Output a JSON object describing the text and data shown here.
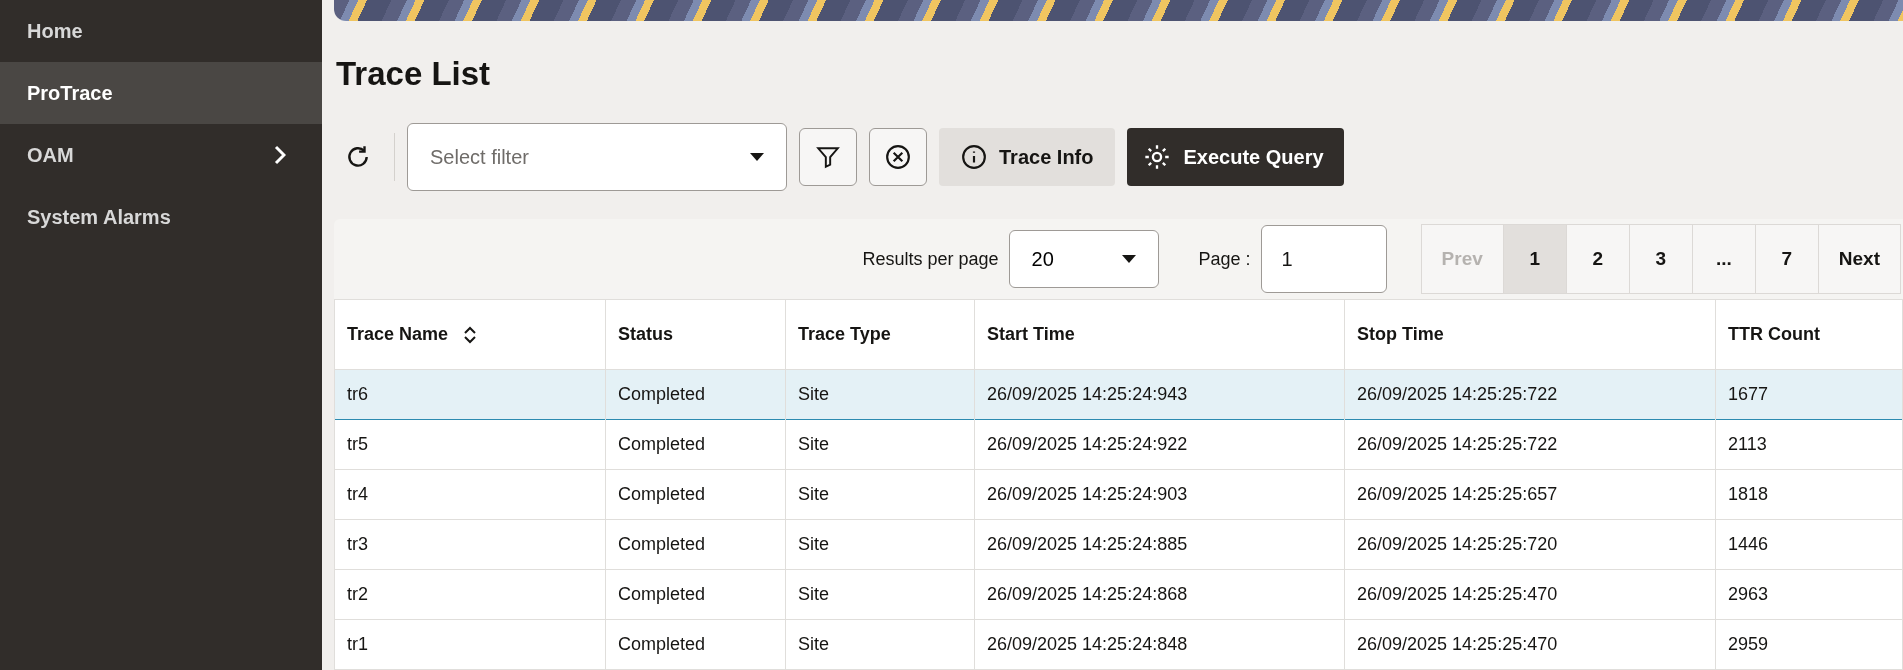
{
  "sidebar": {
    "items": [
      {
        "label": "Home",
        "selected": false,
        "expandable": false
      },
      {
        "label": "ProTrace",
        "selected": true,
        "expandable": false
      },
      {
        "label": "OAM",
        "selected": false,
        "expandable": true
      },
      {
        "label": "System Alarms",
        "selected": false,
        "expandable": false
      }
    ]
  },
  "page_title": "Trace List",
  "toolbar": {
    "filter": {
      "placeholder": "Select filter"
    },
    "trace_info_button": "Trace Info",
    "execute_button": "Execute Query"
  },
  "pagination": {
    "results_label": "Results per page",
    "results_value": "20",
    "page_label": "Page :",
    "page_value": "1",
    "pages": [
      {
        "label": "Prev",
        "selected": false,
        "disabled": true
      },
      {
        "label": "1",
        "selected": true,
        "disabled": false
      },
      {
        "label": "2",
        "selected": false,
        "disabled": false
      },
      {
        "label": "3",
        "selected": false,
        "disabled": false
      },
      {
        "label": "...",
        "selected": false,
        "disabled": false
      },
      {
        "label": "7",
        "selected": false,
        "disabled": false
      },
      {
        "label": "Next",
        "selected": false,
        "disabled": false
      }
    ]
  },
  "table": {
    "columns": [
      {
        "label": "Trace Name",
        "sortable": true
      },
      {
        "label": "Status",
        "sortable": false
      },
      {
        "label": "Trace Type",
        "sortable": false
      },
      {
        "label": "Start Time",
        "sortable": false
      },
      {
        "label": "Stop Time",
        "sortable": false
      },
      {
        "label": "TTR Count",
        "sortable": false
      }
    ],
    "rows": [
      {
        "selected": true,
        "cells": [
          "tr6",
          "Completed",
          "Site",
          "26/09/2025 14:25:24:943",
          "26/09/2025 14:25:25:722",
          "1677"
        ]
      },
      {
        "selected": false,
        "cells": [
          "tr5",
          "Completed",
          "Site",
          "26/09/2025 14:25:24:922",
          "26/09/2025 14:25:25:722",
          "2113"
        ]
      },
      {
        "selected": false,
        "cells": [
          "tr4",
          "Completed",
          "Site",
          "26/09/2025 14:25:24:903",
          "26/09/2025 14:25:25:657",
          "1818"
        ]
      },
      {
        "selected": false,
        "cells": [
          "tr3",
          "Completed",
          "Site",
          "26/09/2025 14:25:24:885",
          "26/09/2025 14:25:25:720",
          "1446"
        ]
      },
      {
        "selected": false,
        "cells": [
          "tr2",
          "Completed",
          "Site",
          "26/09/2025 14:25:24:868",
          "26/09/2025 14:25:25:470",
          "2963"
        ]
      },
      {
        "selected": false,
        "cells": [
          "tr1",
          "Completed",
          "Site",
          "26/09/2025 14:25:24:848",
          "26/09/2025 14:25:25:470",
          "2959"
        ]
      }
    ]
  }
}
